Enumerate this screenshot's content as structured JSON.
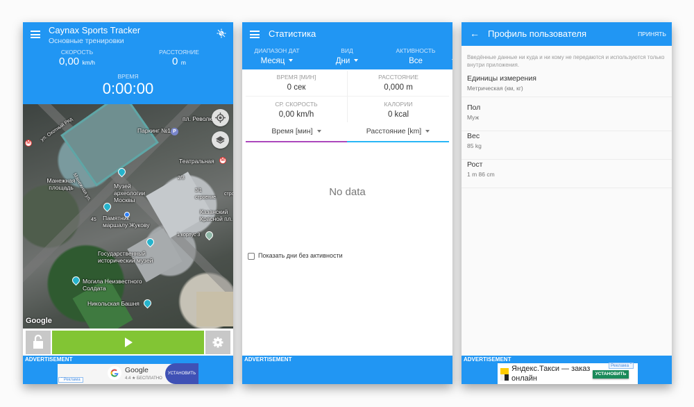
{
  "colors": {
    "primary": "#2196f3",
    "play": "#82c534",
    "tab_time": "#ab47bc",
    "tab_distance": "#29b6f6"
  },
  "tracker": {
    "title": "Caynax Sports Tracker",
    "subtitle": "Основные тренировки",
    "gps_icon": "gps-off-icon",
    "speed": {
      "label": "СКОРОСТЬ",
      "value": "0,00",
      "unit": "km/h"
    },
    "distance": {
      "label": "РАССТОЯНИЕ",
      "value": "0",
      "unit": "m"
    },
    "time": {
      "label": "ВРЕМЯ",
      "value": "0:00:00"
    },
    "map": {
      "labels": [
        "ул. Охотный Ряд",
        "Паркинг №1",
        "пл. Револю...",
        "Театральная",
        "Манежная площадь",
        "Манежная ул.",
        "Музей археологии Москвы",
        "2/3",
        "3/1 строение",
        "строен",
        "Памятник маршалу Жукову",
        "45",
        "Казанский Красной пл.",
        "1 корпус 3",
        "Государственный исторический музей",
        "Могила Неизвестного Солдата",
        "Никольская Башня"
      ],
      "attribution": "Google"
    },
    "controls": {
      "lock_icon": "lock-open-icon",
      "play_icon": "play-icon",
      "settings_icon": "gear-icon"
    },
    "ad": {
      "label": "ADVERTISEMENT",
      "app_name": "Google",
      "app_meta": "4.4 ★ БЕСПЛАТНО",
      "install": "УСТАНОВИТЬ",
      "tag": "ˇ Реклама"
    }
  },
  "stats": {
    "title": "Статистика",
    "filters": [
      {
        "label": "ДИАПАЗОН ДАТ",
        "value": "Месяц"
      },
      {
        "label": "ВИД",
        "value": "Дни"
      },
      {
        "label": "АКТИВНОСТЬ",
        "value": "Все"
      }
    ],
    "cells": [
      {
        "label": "ВРЕМЯ [МИН]",
        "value": "0 сек"
      },
      {
        "label": "РАССТОЯНИЕ",
        "value": "0,000 m"
      },
      {
        "label": "СР. СКОРОСТЬ",
        "value": "0,00 km/h"
      },
      {
        "label": "КАЛОРИИ",
        "value": "0 kcal"
      }
    ],
    "tabs": [
      {
        "label": "Время [мин]"
      },
      {
        "label": "Расстояние [km]"
      }
    ],
    "empty": "No data",
    "checkbox": {
      "label": "Показать дни без активности",
      "checked": false
    },
    "ad_label": "ADVERTISEMENT"
  },
  "profile": {
    "title": "Профиль пользователя",
    "accept": "ПРИНЯТЬ",
    "note": "Введённые данные ни куда и ни кому не передаются и используются только внутри приложения.",
    "prefs": [
      {
        "key": "Единицы измерения",
        "value": "Метрическая (км, кг)"
      },
      {
        "key": "Пол",
        "value": "Муж"
      },
      {
        "key": "Вес",
        "value": "85 kg"
      },
      {
        "key": "Рост",
        "value": "1 m 86 cm"
      }
    ],
    "ad": {
      "label": "ADVERTISEMENT",
      "text": "Яндекс.Такси — заказ онлайн",
      "install": "УСТАНОВИТЬ",
      "tag": "Реклама ˇ"
    }
  }
}
